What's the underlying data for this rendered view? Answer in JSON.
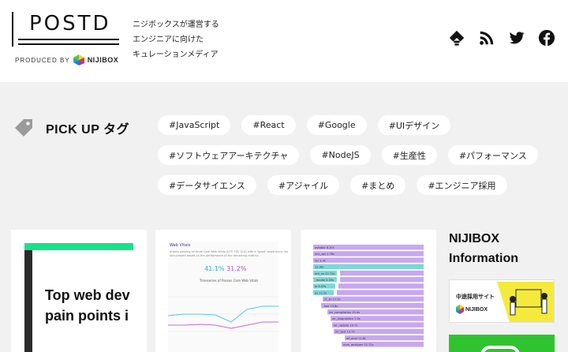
{
  "header": {
    "logo_word": "POSTD",
    "produced_by": "PRODUCED BY",
    "produced_brand": "NIJIBOX",
    "tagline": [
      "ニジボックスが運営する",
      "エンジニアに向けた",
      "キュレーションメディア"
    ],
    "social": [
      "feedly-icon",
      "rss-icon",
      "twitter-icon",
      "facebook-icon"
    ]
  },
  "pickup": {
    "label": "PICK UP タグ",
    "tags": [
      "#JavaScript",
      "#React",
      "#Google",
      "#UIデザイン",
      "#ソフトウェアアーキテクチャ",
      "#NodeJS",
      "#生産性",
      "#パフォーマンス",
      "#データサイエンス",
      "#アジャイル",
      "#まとめ",
      "#エンジニア採用"
    ]
  },
  "cards": {
    "card1": {
      "title_lines": [
        "Top web dev",
        "pain points i"
      ]
    },
    "card2": {
      "heading": "Web Vitals",
      "lines": [
        "origins passing all three Core Web Vitals (LCP, FID, CLS) with a \"good\" experience. No",
        "ions passed based on the performance of the remaining metrics."
      ],
      "pct_a": "41.1%",
      "pct_b": "31.2%",
      "chart_title": "Timeseries of Passes Core Web Vitals"
    },
    "card3": {
      "rows": [
        "ovtable 6.10s",
        "unc_api 1.78s",
        "rer 1.9s",
        "12.9fs",
        "ent_nv 22.72s",
        "_modal 4.35s",
        "jo 6.47s",
        "ex 11.5s",
        "nt_sh 17.0s",
        "_box 13.8s",
        "ivx_compilation 15.4s",
        "nlr_diagnostics 7.0s",
        "nlr_update 19.7s",
        "nlr_test 13.7s",
        "wf_anal 11.8s",
        "num_analyzer 22.72s"
      ]
    }
  },
  "info": {
    "title_lines": [
      "NIJIBOX",
      "Information"
    ],
    "banner_text": "中途採用サイト",
    "banner_brand": "NIJIBOX"
  },
  "colors": {
    "accent_green": "#18e38a",
    "banner_yellow": "#f4ea3c",
    "block_green": "#2fc42f",
    "bar_purple": "#c7a8f0",
    "bar_teal": "#7fd6d8"
  }
}
